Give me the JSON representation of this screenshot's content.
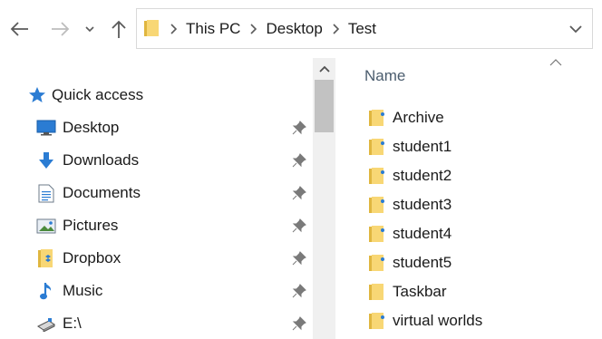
{
  "colors": {
    "folder_yellow": "#f8d775",
    "folder_dark": "#e0b63f",
    "accent_blue": "#2b7cd3",
    "pin_gray": "#7a7a7a",
    "header_text": "#4b5d6e",
    "scrollbar_track": "#f0f0f0",
    "scrollbar_thumb": "#c2c2c2"
  },
  "toolbar": {
    "back_icon": "back-arrow-icon",
    "forward_icon": "forward-arrow-icon",
    "recent_icon": "chevron-down-icon",
    "up_icon": "up-arrow-icon"
  },
  "address": {
    "folder_icon": "folder-icon",
    "crumbs": [
      "This PC",
      "Desktop",
      "Test"
    ],
    "separator_icon": "chevron-right-icon",
    "dropdown_icon": "chevron-down-icon"
  },
  "navpane": {
    "quick_access": {
      "label": "Quick access",
      "icon": "star-icon"
    },
    "items": [
      {
        "label": "Desktop",
        "icon": "desktop-icon",
        "pinned": true
      },
      {
        "label": "Downloads",
        "icon": "download-icon",
        "pinned": true
      },
      {
        "label": "Documents",
        "icon": "document-icon",
        "pinned": true
      },
      {
        "label": "Pictures",
        "icon": "picture-icon",
        "pinned": true
      },
      {
        "label": "Dropbox",
        "icon": "dropbox-icon",
        "pinned": true
      },
      {
        "label": "Music",
        "icon": "music-icon",
        "pinned": true
      },
      {
        "label": "E:\\",
        "icon": "usb-drive-icon",
        "pinned": true
      }
    ]
  },
  "content": {
    "column_header": "Name",
    "sort": "ascending",
    "files": [
      {
        "name": "Archive",
        "icon": "folder-icon"
      },
      {
        "name": "student1",
        "icon": "folder-icon"
      },
      {
        "name": "student2",
        "icon": "folder-icon"
      },
      {
        "name": "student3",
        "icon": "folder-icon"
      },
      {
        "name": "student4",
        "icon": "folder-icon"
      },
      {
        "name": "student5",
        "icon": "folder-icon"
      },
      {
        "name": "Taskbar",
        "icon": "folder-icon"
      },
      {
        "name": "virtual worlds",
        "icon": "folder-icon"
      }
    ]
  }
}
